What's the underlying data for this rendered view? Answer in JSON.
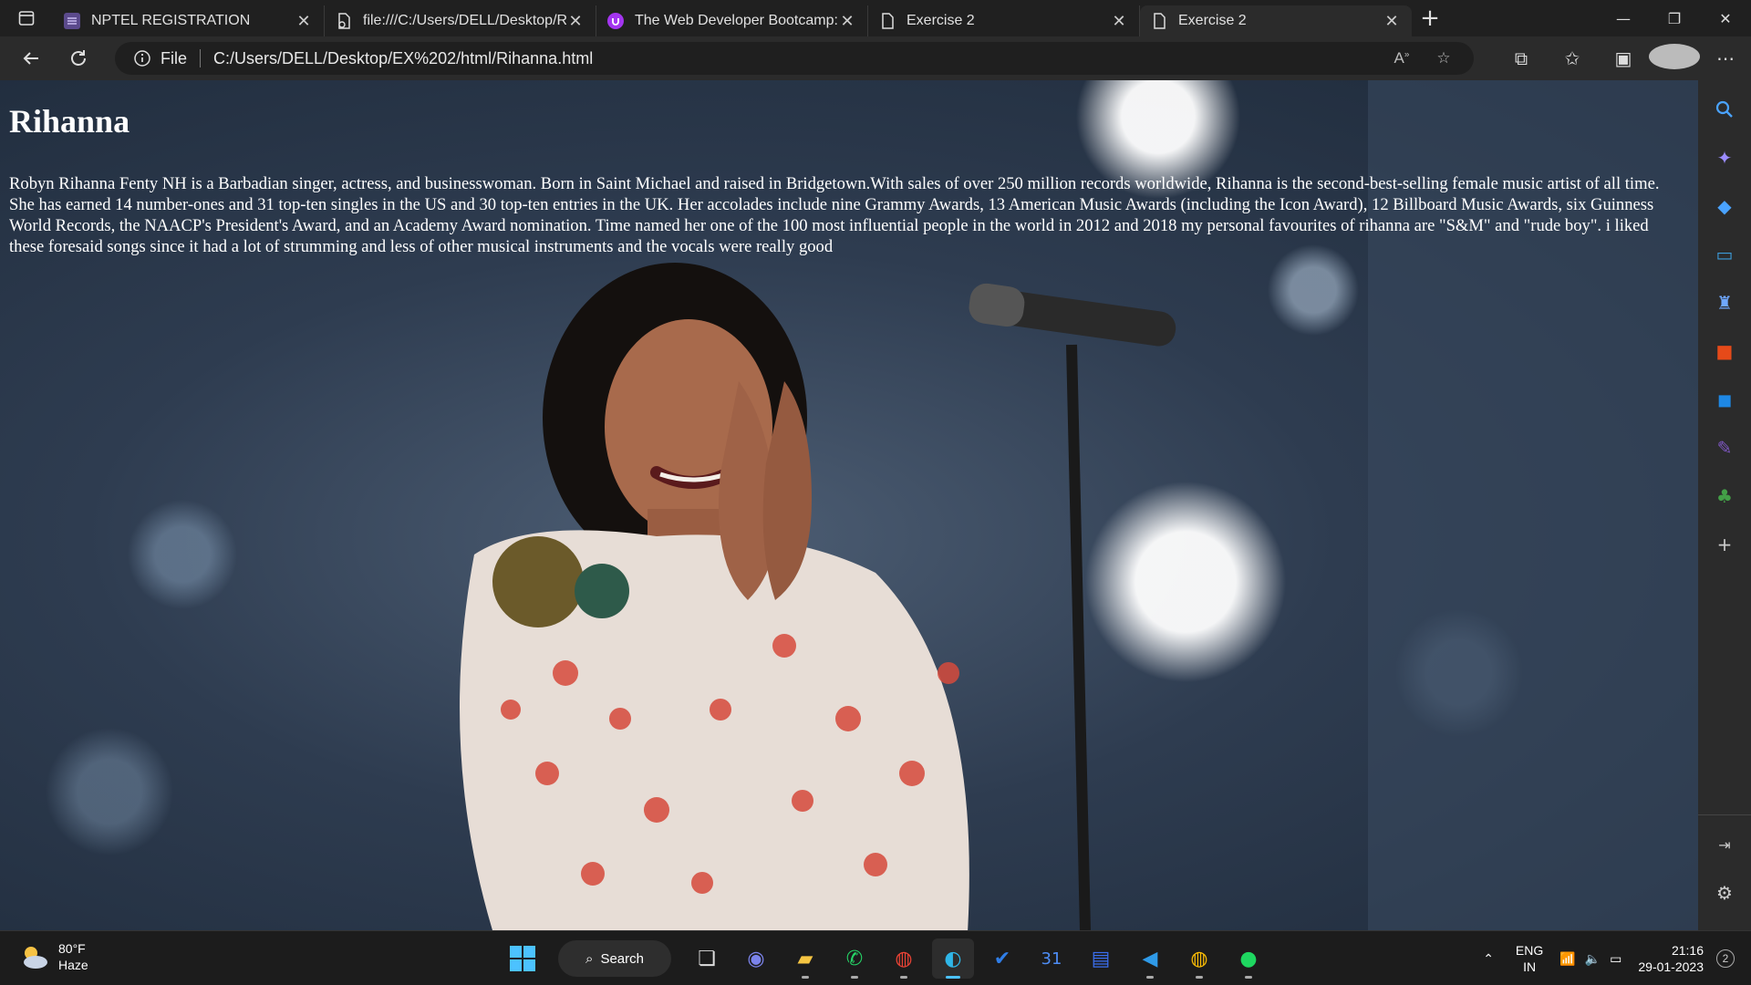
{
  "browser": {
    "tabs": [
      {
        "title": "NPTEL REGISTRATION",
        "icon": "list-icon",
        "active": false
      },
      {
        "title": "file:///C:/Users/DELL/Desktop/Ri",
        "icon": "file-link-icon",
        "active": false
      },
      {
        "title": "The Web Developer Bootcamp: L",
        "icon": "udemy-icon",
        "active": false
      },
      {
        "title": "Exercise 2",
        "icon": "page-icon",
        "active": false
      },
      {
        "title": "Exercise 2",
        "icon": "page-icon",
        "active": true
      }
    ],
    "address": {
      "scheme_label": "File",
      "url": "C:/Users/DELL/Desktop/EX%202/html/Rihanna.html"
    }
  },
  "page": {
    "heading": "Rihanna",
    "paragraph": "Robyn Rihanna Fenty NH is a Barbadian singer, actress, and businesswoman. Born in Saint Michael and raised in Bridgetown.With sales of over 250 million records worldwide, Rihanna is the second-best-selling female music artist of all time. She has earned 14 number-ones and 31 top-ten singles in the US and 30 top-ten entries in the UK. Her accolades include nine Grammy Awards, 13 American Music Awards (including the Icon Award), 12 Billboard Music Awards, six Guinness World Records, the NAACP's President's Award, and an Academy Award nomination. Time named her one of the 100 most influential people in the world in 2012 and 2018 my personal favourites of rihanna are \"S&M\" and \"rude boy\". i liked these foresaid songs since it had a lot of strumming and less of other musical instruments and the vocals were really good"
  },
  "taskbar": {
    "weather": {
      "temp": "80°F",
      "condition": "Haze"
    },
    "search_label": "Search",
    "tray": {
      "lang1": "ENG",
      "lang2": "IN",
      "time": "21:16",
      "date": "29-01-2023",
      "notifications": "2"
    }
  },
  "colors": {
    "tab_bar": "#202020",
    "toolbar": "#2b2b2b",
    "page_text": "#ffffff",
    "taskbar": "#1c1c1c"
  }
}
